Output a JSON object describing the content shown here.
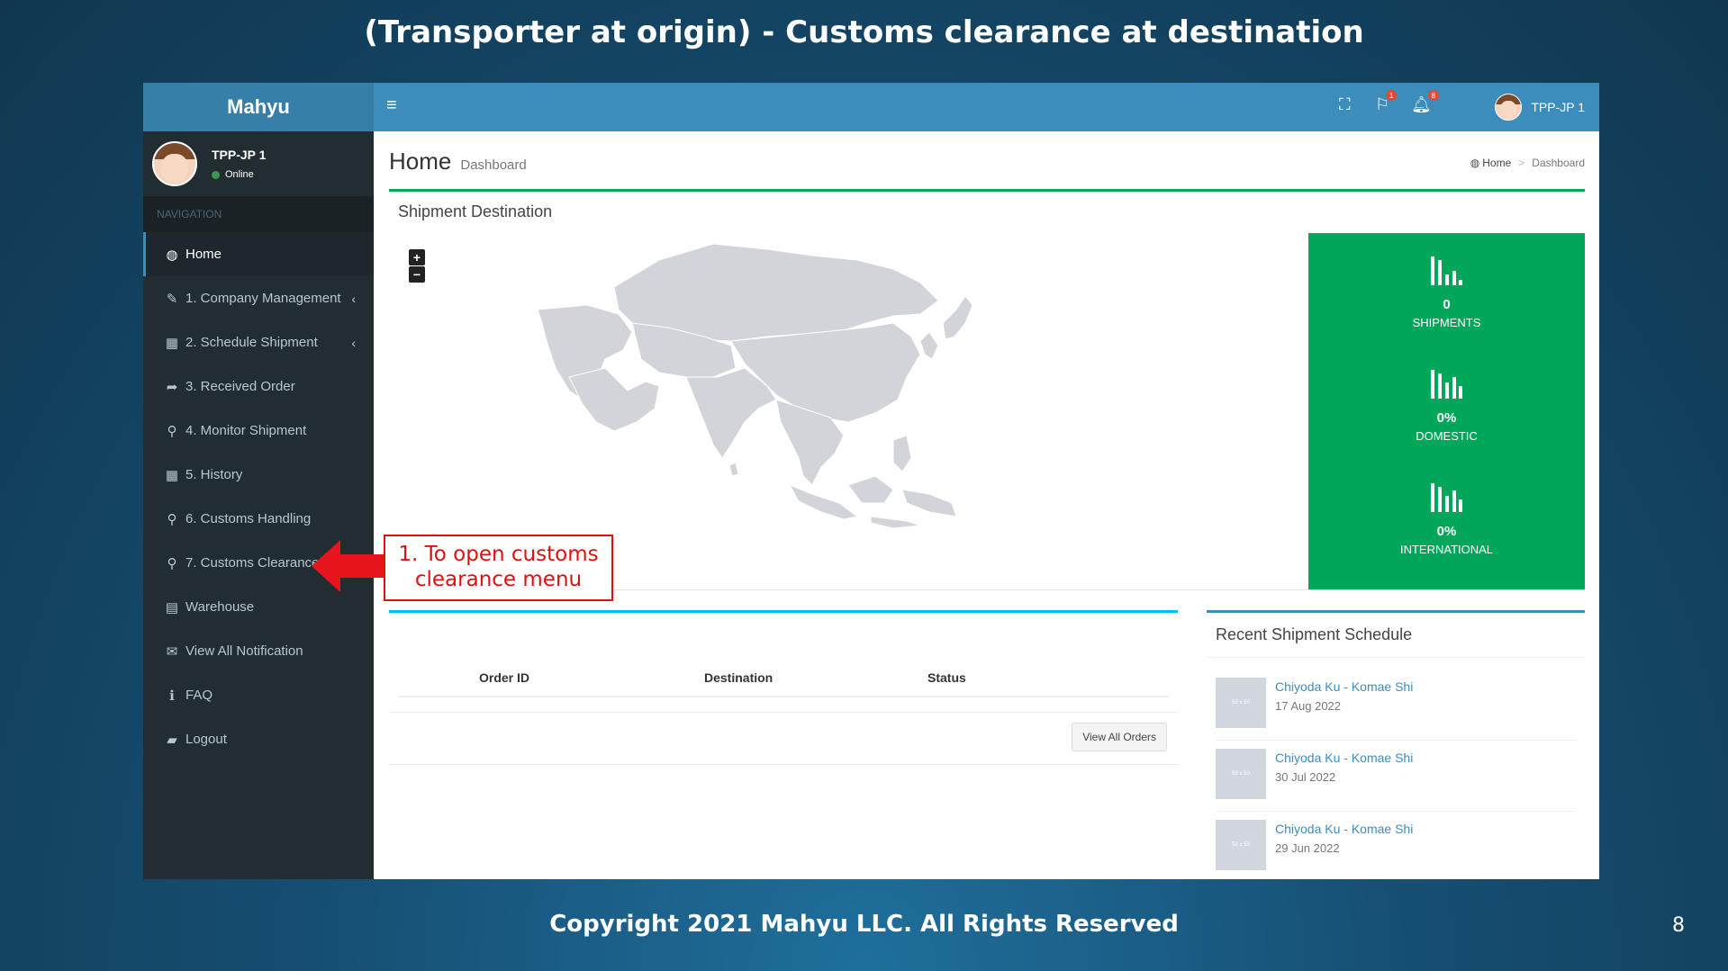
{
  "slide": {
    "title": "(Transporter at origin) - Customs clearance at destination",
    "footer": "Copyright 2021 Mahyu LLC. All Rights Reserved",
    "page_number": "8"
  },
  "app": {
    "brand": "Mahyu",
    "user": {
      "name": "TPP-JP 1",
      "status": "Online"
    },
    "nav_header": "NAVIGATION",
    "nav": [
      {
        "label": "Home",
        "icon": "dashboard-icon"
      },
      {
        "label": "1. Company Management",
        "icon": "edit-icon"
      },
      {
        "label": "2. Schedule Shipment",
        "icon": "calendar-icon"
      },
      {
        "label": "3. Received Order",
        "icon": "share-icon"
      },
      {
        "label": "4. Monitor Shipment",
        "icon": "search-icon"
      },
      {
        "label": "5. History",
        "icon": "calendar-icon"
      },
      {
        "label": "6. Customs Handling",
        "icon": "search-icon"
      },
      {
        "label": "7. Customs Clearance",
        "icon": "search-icon"
      },
      {
        "label": "Warehouse",
        "icon": "warehouse-icon"
      },
      {
        "label": "View All Notification",
        "icon": "envelope-icon"
      },
      {
        "label": "FAQ",
        "icon": "info-icon"
      },
      {
        "label": "Logout",
        "icon": "book-icon"
      }
    ],
    "header": {
      "flag_badge": "1",
      "bell_badge": "8",
      "user_name": "TPP-JP 1"
    },
    "page": {
      "title": "Home",
      "subtitle": "Dashboard",
      "breadcrumb": [
        "Home",
        "Dashboard"
      ]
    },
    "map_box": {
      "title": "Shipment Destination",
      "zoom_in": "+",
      "zoom_out": "−"
    },
    "stats": [
      {
        "value": "0",
        "label": "SHIPMENTS"
      },
      {
        "value": "0%",
        "label": "DOMESTIC"
      },
      {
        "value": "0%",
        "label": "INTERNATIONAL"
      }
    ],
    "orders": {
      "columns": [
        "Order ID",
        "Destination",
        "Status"
      ],
      "view_all": "View All Orders"
    },
    "recent": {
      "title": "Recent Shipment Schedule",
      "thumb_text": "50 x 50",
      "items": [
        {
          "name": "Chiyoda Ku - Komae Shi",
          "date": "17 Aug 2022"
        },
        {
          "name": "Chiyoda Ku - Komae Shi",
          "date": "30 Jul 2022"
        },
        {
          "name": "Chiyoda Ku - Komae Shi",
          "date": "29 Jun 2022"
        }
      ]
    }
  },
  "callout": {
    "line1": "1. To open customs",
    "line2": "clearance menu",
    "color": "#dd1111"
  },
  "colors": {
    "header": "#3c8dbc",
    "sidebar": "#222d32",
    "stats": "#00a65a"
  }
}
